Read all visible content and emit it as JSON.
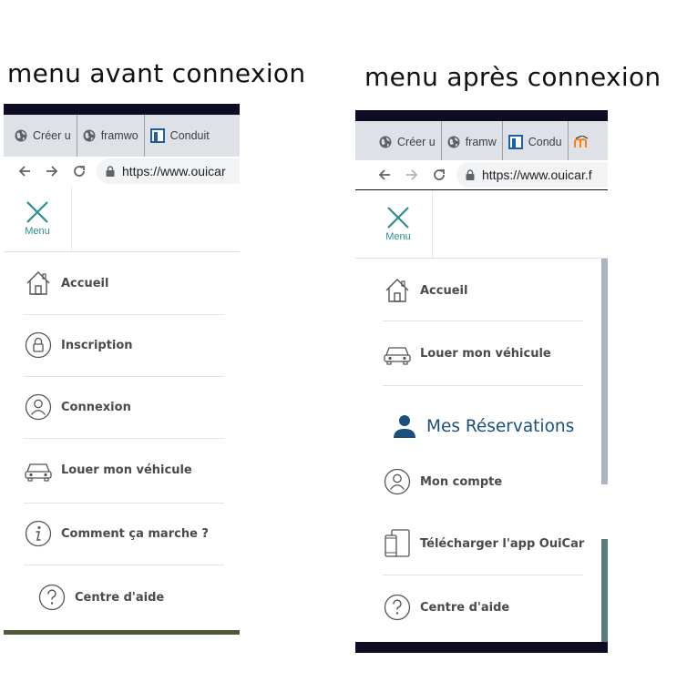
{
  "captions": {
    "before": "menu avant connexion",
    "after": "menu après connexion"
  },
  "before": {
    "tabs": [
      {
        "label": "Créer u",
        "icon": "globe-icon"
      },
      {
        "label": "framwo",
        "icon": "globe-icon"
      },
      {
        "label": "Conduit",
        "icon": "conduit-icon"
      }
    ],
    "url": "https://www.ouicar",
    "menu_label": "Menu",
    "items": [
      {
        "label": "Accueil",
        "icon": "home-icon"
      },
      {
        "label": "Inscription",
        "icon": "lock-icon"
      },
      {
        "label": "Connexion",
        "icon": "user-icon"
      },
      {
        "label": "Louer mon véhicule",
        "icon": "car-icon"
      },
      {
        "label": "Comment ça marche ?",
        "icon": "info-icon"
      },
      {
        "label": "Centre d'aide",
        "icon": "help-icon"
      }
    ]
  },
  "after": {
    "tabs": [
      {
        "label": "Créer u",
        "icon": "globe-icon"
      },
      {
        "label": "framw",
        "icon": "globe-icon"
      },
      {
        "label": "Condu",
        "icon": "conduit-icon"
      },
      {
        "label": "",
        "icon": "moodle-icon"
      }
    ],
    "url": "https://www.ouicar.f",
    "menu_label": "Menu",
    "items": [
      {
        "label": "Accueil",
        "icon": "home-icon"
      },
      {
        "label": "Louer mon véhicule",
        "icon": "car-icon"
      }
    ],
    "reservations": {
      "label": "Mes Réservations",
      "icon": "person-filled-icon"
    },
    "items2": [
      {
        "label": "Mon compte",
        "icon": "user-icon"
      },
      {
        "label": "Télécharger l'app OuiCar",
        "icon": "devices-icon"
      },
      {
        "label": "Centre d'aide",
        "icon": "help-icon"
      }
    ]
  },
  "colors": {
    "accent_teal": "#2a8f8d",
    "reservation_blue": "#1a4f7d",
    "menu_text": "#4a4a4a",
    "tabbar": "#dee1e6"
  }
}
